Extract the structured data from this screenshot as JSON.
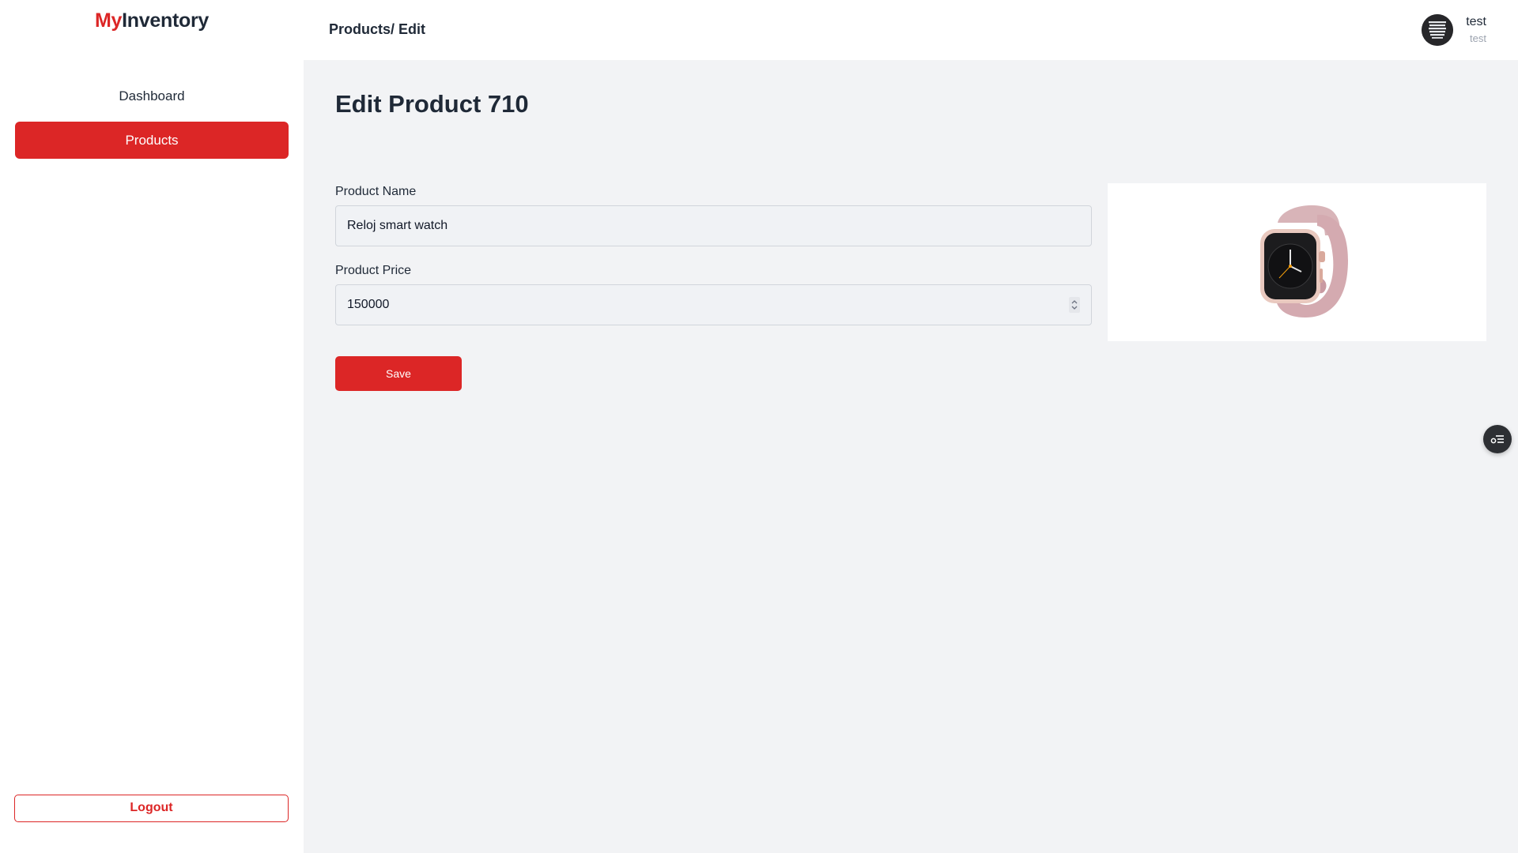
{
  "app": {
    "logo_prefix": "My",
    "logo_suffix": "Inventory",
    "accent_color": "#dc2626"
  },
  "sidebar": {
    "items": [
      {
        "label": "Dashboard",
        "active": false
      },
      {
        "label": "Products",
        "active": true
      }
    ],
    "logout_label": "Logout"
  },
  "header": {
    "breadcrumb": "Products/ Edit",
    "user": {
      "name": "test",
      "subtitle": "test",
      "avatar_icon": "keep-your-head-in-the-clouds-avatar"
    }
  },
  "main": {
    "title": "Edit Product 710",
    "form": {
      "name_label": "Product Name",
      "name_value": "Reloj smart watch",
      "price_label": "Product Price",
      "price_value": "150000",
      "save_label": "Save"
    },
    "image": {
      "subject": "rose gold smart watch with pink band"
    },
    "floating_button_icon": "list-settings-icon"
  }
}
